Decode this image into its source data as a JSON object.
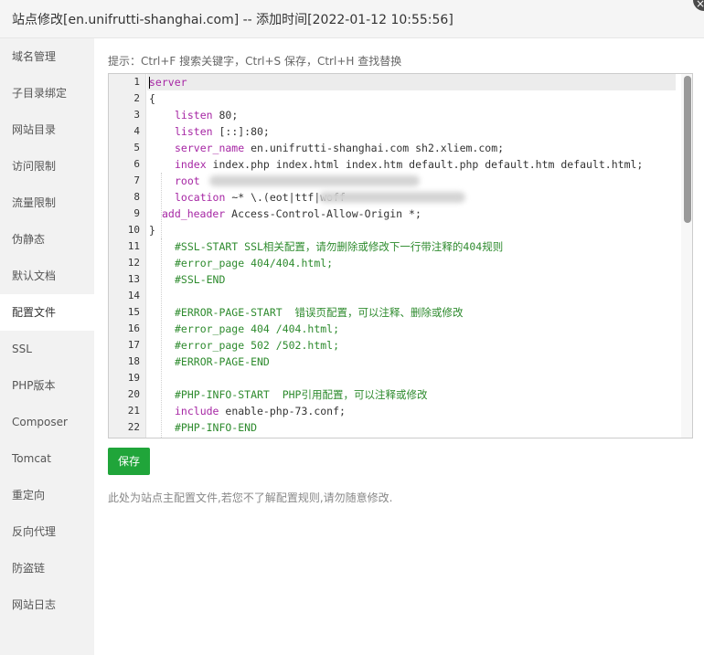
{
  "dialog": {
    "title": "站点修改[en.unifrutti-shanghai.com] -- 添加时间[2022-01-12 10:55:56]",
    "close_icon": "×"
  },
  "sidebar": {
    "items": [
      {
        "label": "域名管理"
      },
      {
        "label": "子目录绑定"
      },
      {
        "label": "网站目录"
      },
      {
        "label": "访问限制"
      },
      {
        "label": "流量限制"
      },
      {
        "label": "伪静态"
      },
      {
        "label": "默认文档"
      },
      {
        "label": "配置文件",
        "active": true
      },
      {
        "label": "SSL"
      },
      {
        "label": "PHP版本"
      },
      {
        "label": "Composer"
      },
      {
        "label": "Tomcat"
      },
      {
        "label": "重定向"
      },
      {
        "label": "反向代理"
      },
      {
        "label": "防盗链"
      },
      {
        "label": "网站日志"
      }
    ]
  },
  "main": {
    "tip": "提示：Ctrl+F 搜索关键字，Ctrl+S 保存，Ctrl+H 查找替换",
    "editor": {
      "line_numbers": [
        "1",
        "2",
        "3",
        "4",
        "5",
        "6",
        "7",
        "8",
        "9",
        "10",
        "11",
        "12",
        "13",
        "14",
        "15",
        "16",
        "17",
        "18",
        "19",
        "20",
        "21",
        "22"
      ],
      "lines": [
        {
          "kw": "server",
          "text": ""
        },
        {
          "kw": "",
          "text": "{"
        },
        {
          "kw": "listen",
          "text": " 80;"
        },
        {
          "kw": "listen",
          "text": " [::]:80;"
        },
        {
          "kw": "server_name",
          "text": " en.unifrutti-shanghai.com sh2.xliem.com;"
        },
        {
          "kw": "index",
          "text": " index.php index.html index.htm default.php default.htm default.html;"
        },
        {
          "kw": "root",
          "text": ""
        },
        {
          "kw": "location",
          "text": " ~* \\.(eot|ttf|woff"
        },
        {
          "kw": "add_header",
          "text": " Access-Control-Allow-Origin *;"
        },
        {
          "kw": "",
          "text": "}"
        },
        {
          "comment": "#SSL-START SSL相关配置，请勿删除或修改下一行带注释的404规则"
        },
        {
          "comment": "#error_page 404/404.html;"
        },
        {
          "comment": "#SSL-END"
        },
        {
          "text": ""
        },
        {
          "comment": "#ERROR-PAGE-START  错误页配置，可以注释、删除或修改"
        },
        {
          "comment": "#error_page 404 /404.html;"
        },
        {
          "comment": "#error_page 502 /502.html;"
        },
        {
          "comment": "#ERROR-PAGE-END"
        },
        {
          "text": ""
        },
        {
          "comment": "#PHP-INFO-START  PHP引用配置，可以注释或修改"
        },
        {
          "kw": "include",
          "text": " enable-php-73.conf;"
        },
        {
          "comment": "#PHP-INFO-END"
        }
      ],
      "root_tail": "/en;"
    },
    "save_label": "保存",
    "note": "此处为站点主配置文件,若您不了解配置规则,请勿随意修改."
  }
}
